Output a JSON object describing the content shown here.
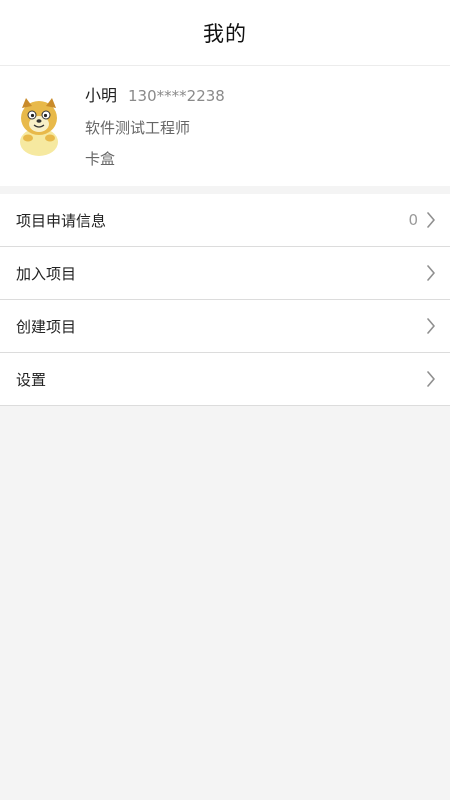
{
  "header": {
    "title": "我的"
  },
  "profile": {
    "name": "小明",
    "phone": "130****2238",
    "job_title": "软件测试工程师",
    "company": "卡盒",
    "avatar_icon": "dog-avatar-icon"
  },
  "menu": {
    "items": [
      {
        "label": "项目申请信息",
        "count": "0",
        "icon": "chevron-right-icon"
      },
      {
        "label": "加入项目",
        "icon": "chevron-right-icon"
      },
      {
        "label": "创建项目",
        "icon": "chevron-right-icon"
      },
      {
        "label": "设置",
        "icon": "chevron-right-icon"
      }
    ]
  },
  "colors": {
    "background": "#f4f4f4",
    "card": "#ffffff",
    "divider": "#dcdcdc",
    "secondary_text": "#8a8a8a"
  }
}
